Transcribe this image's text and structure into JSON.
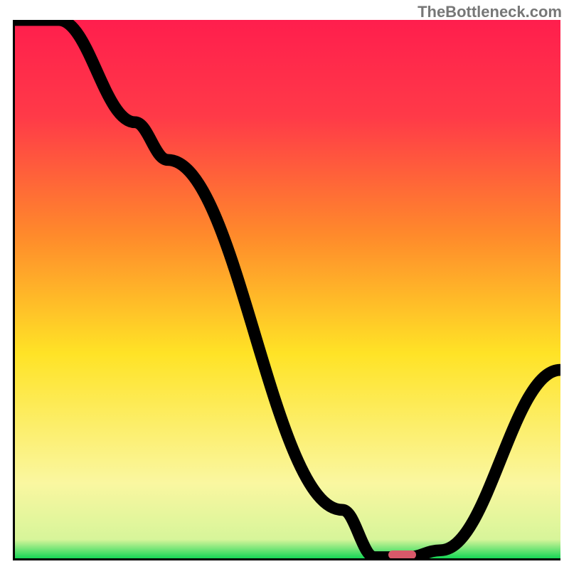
{
  "watermark": "TheBottleneck.com",
  "colors": {
    "grad_top": "#ff1e4d",
    "grad_orange": "#ff8a2b",
    "grad_yellow": "#ffe326",
    "grad_pale_yellow": "#faf7a0",
    "grad_green": "#16d656",
    "curve": "#000000",
    "marker": "#d9596a",
    "axis": "#000000"
  },
  "gradient_stops": [
    {
      "offset": 0.0,
      "color": "#ff1e4d"
    },
    {
      "offset": 0.18,
      "color": "#ff3a48"
    },
    {
      "offset": 0.4,
      "color": "#ff8a2b"
    },
    {
      "offset": 0.62,
      "color": "#ffe326"
    },
    {
      "offset": 0.86,
      "color": "#faf7a0"
    },
    {
      "offset": 0.965,
      "color": "#d7f59a"
    },
    {
      "offset": 1.0,
      "color": "#16d656"
    }
  ],
  "chart_data": {
    "type": "line",
    "title": "",
    "xlabel": "",
    "ylabel": "",
    "xlim": [
      0,
      100
    ],
    "ylim": [
      0,
      100
    ],
    "x": [
      0,
      8,
      22,
      28,
      60,
      66,
      72,
      78,
      100
    ],
    "values": [
      100,
      100,
      81,
      74,
      9,
      0.2,
      0.2,
      1.5,
      35
    ],
    "flat_segment_x": [
      66,
      72
    ],
    "marker_x": [
      68.5,
      73.5
    ],
    "marker_y": 0.6,
    "description": "Single black curve on a vertical rainbow gradient. Curve starts at top-left (~100), slight shoulder around x≈25, drops steeply to a flat valley near y≈0 around x≈66–72, then rises to ~35 at x=100. A small rounded red/pink pill sits on the flat valley."
  }
}
